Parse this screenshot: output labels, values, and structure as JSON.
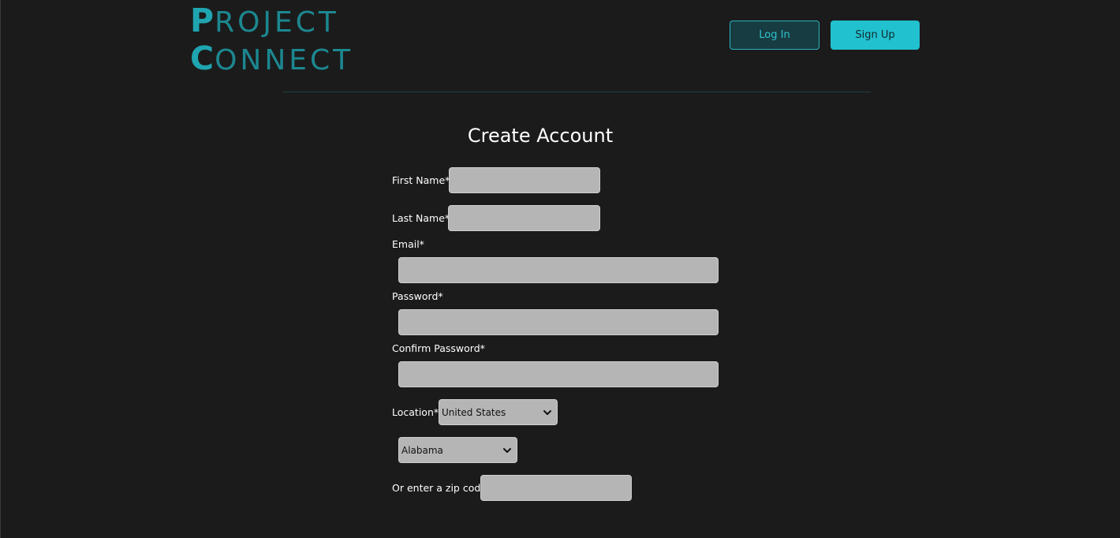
{
  "header": {
    "logo": {
      "line1_first": "P",
      "line1_rest": "ROJECT",
      "line2_first": "C",
      "line2_rest": "ONNECT"
    },
    "login_label": "Log In",
    "signup_label": "Sign Up"
  },
  "form": {
    "title": "Create Account",
    "first_name_label": "First Name*",
    "first_name_value": "",
    "last_name_label": "Last Name*",
    "last_name_value": "",
    "email_label": "Email*",
    "email_value": "",
    "password_label": "Password*",
    "password_value": "",
    "confirm_password_label": "Confirm Password*",
    "confirm_password_value": "",
    "location_label": "Location*",
    "country_selected": "United States",
    "state_selected": "Alabama",
    "zip_label": "Or enter a zip code",
    "zip_value": ""
  },
  "colors": {
    "background": "#1b1b1b",
    "accent": "#22c1cf",
    "logo": "#1fa5b0",
    "input_bg": "#b5b5b5"
  },
  "icons": {
    "select_arrow": "chevron-down-icon"
  }
}
